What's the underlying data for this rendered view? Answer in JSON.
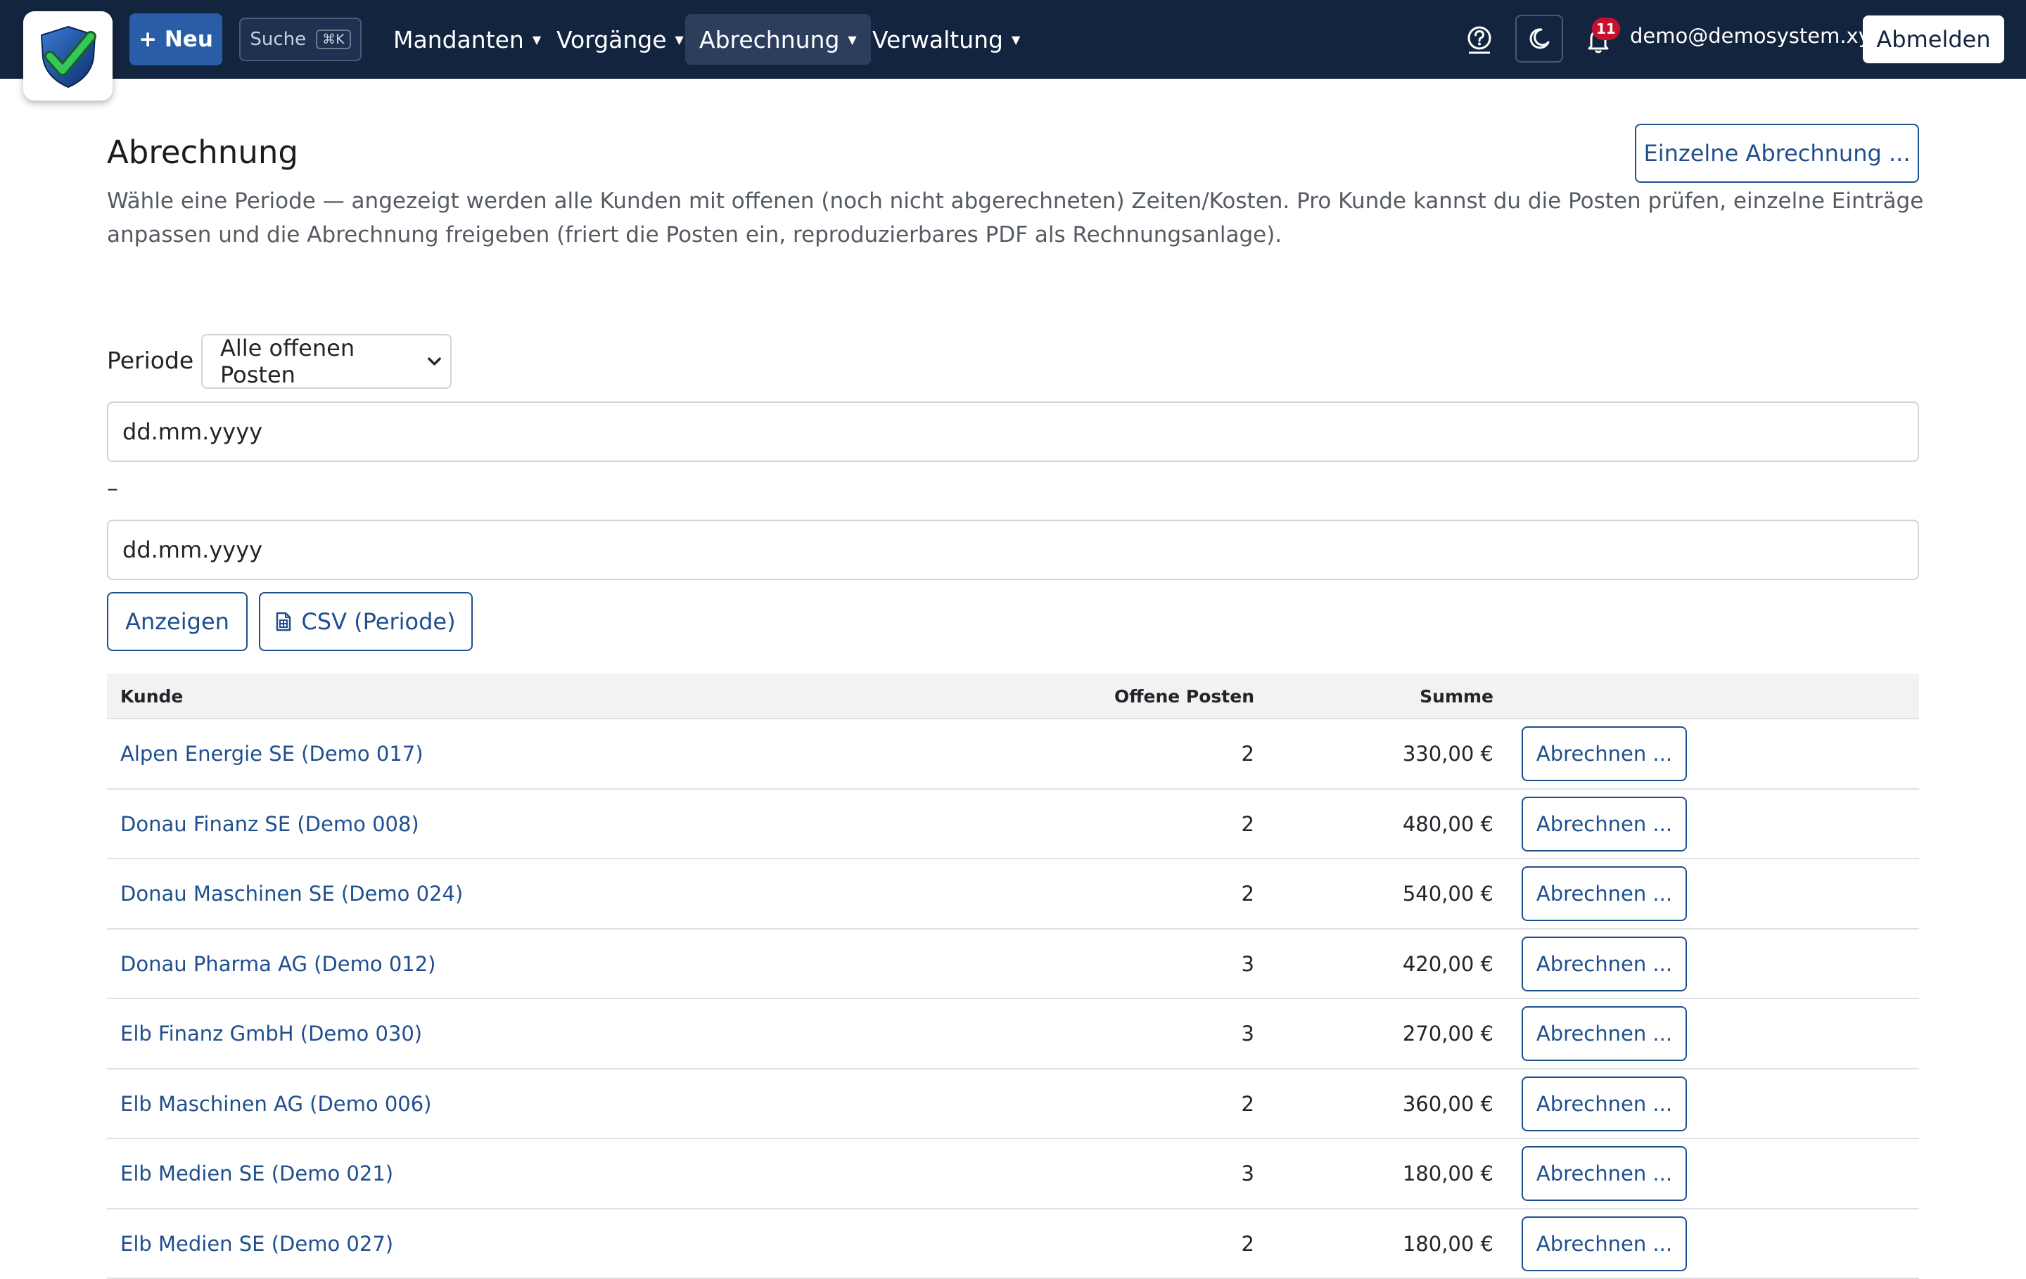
{
  "navbar": {
    "new_label": "+ Neu",
    "search_label": "Suche",
    "search_shortcut": "⌘K",
    "menu": [
      {
        "label": "Mandanten"
      },
      {
        "label": "Vorgänge"
      },
      {
        "label": "Abrechnung"
      },
      {
        "label": "Verwaltung"
      }
    ],
    "notification_count": "11",
    "user_email": "demo@demosystem.xyz",
    "logout_label": "Abmelden"
  },
  "page": {
    "title": "Abrechnung",
    "single_button": "Einzelne Abrechnung ...",
    "intro": "Wähle eine Periode — angezeigt werden alle Kunden mit offenen (noch nicht abgerechneten) Zeiten/Kosten. Pro Kunde kannst du die Posten prüfen, einzelne Einträge anpassen und die Abrechnung freigeben (friert die Posten ein, reproduzierbares PDF als Rechnungsanlage)."
  },
  "filter": {
    "period_label": "Periode",
    "period_value": "Alle offenen Posten",
    "from_placeholder": "dd.mm.yyyy",
    "separator": "–",
    "to_placeholder": "dd.mm.yyyy",
    "show_button": "Anzeigen",
    "csv_button": "CSV (Periode)"
  },
  "table": {
    "headers": {
      "customer": "Kunde",
      "open_items": "Offene Posten",
      "sum": "Summe"
    },
    "action_label": "Abrechnen ...",
    "rows": [
      {
        "customer": "Alpen Energie SE (Demo 017)",
        "open_items": "2",
        "sum": "330,00 €"
      },
      {
        "customer": "Donau Finanz SE (Demo 008)",
        "open_items": "2",
        "sum": "480,00 €"
      },
      {
        "customer": "Donau Maschinen SE (Demo 024)",
        "open_items": "2",
        "sum": "540,00 €"
      },
      {
        "customer": "Donau Pharma AG (Demo 012)",
        "open_items": "3",
        "sum": "420,00 €"
      },
      {
        "customer": "Elb Finanz GmbH (Demo 030)",
        "open_items": "3",
        "sum": "270,00 €"
      },
      {
        "customer": "Elb Maschinen AG (Demo 006)",
        "open_items": "2",
        "sum": "360,00 €"
      },
      {
        "customer": "Elb Medien SE (Demo 021)",
        "open_items": "3",
        "sum": "180,00 €"
      },
      {
        "customer": "Elb Medien SE (Demo 027)",
        "open_items": "2",
        "sum": "180,00 €"
      }
    ]
  },
  "colors": {
    "navbar_bg": "#13243f",
    "primary": "#2a5da8",
    "link": "#1f4f8e",
    "badge": "#c8102e"
  }
}
